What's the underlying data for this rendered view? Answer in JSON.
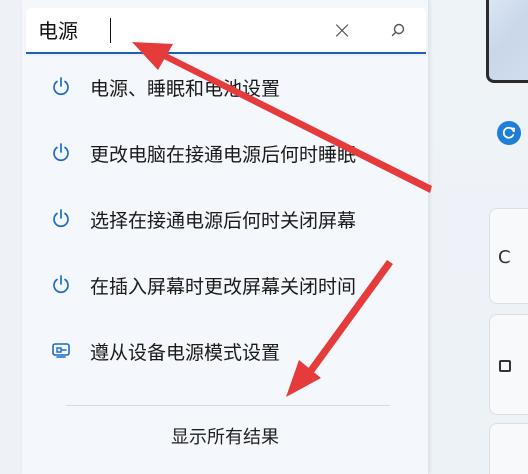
{
  "search": {
    "value": "电源",
    "clear_icon": "close-icon",
    "search_icon": "search-icon"
  },
  "results": [
    {
      "label": "电源、睡眠和电池设置",
      "icon": "power-icon"
    },
    {
      "label": "更改电脑在接通电源后何时睡眠",
      "icon": "power-icon"
    },
    {
      "label": "选择在接通电源后何时关闭屏幕",
      "icon": "power-icon"
    },
    {
      "label": "在插入屏幕时更改屏幕关闭时间",
      "icon": "power-icon"
    },
    {
      "label": "遵从设备电源模式设置",
      "icon": "device-mode-icon"
    }
  ],
  "show_all": "显示所有结果",
  "right_cards": [
    {
      "letter": "C"
    },
    {
      "letter": ""
    },
    {
      "letter": ""
    }
  ],
  "colors": {
    "accent": "#1e5fb8",
    "annotation": "#e53b3b"
  }
}
